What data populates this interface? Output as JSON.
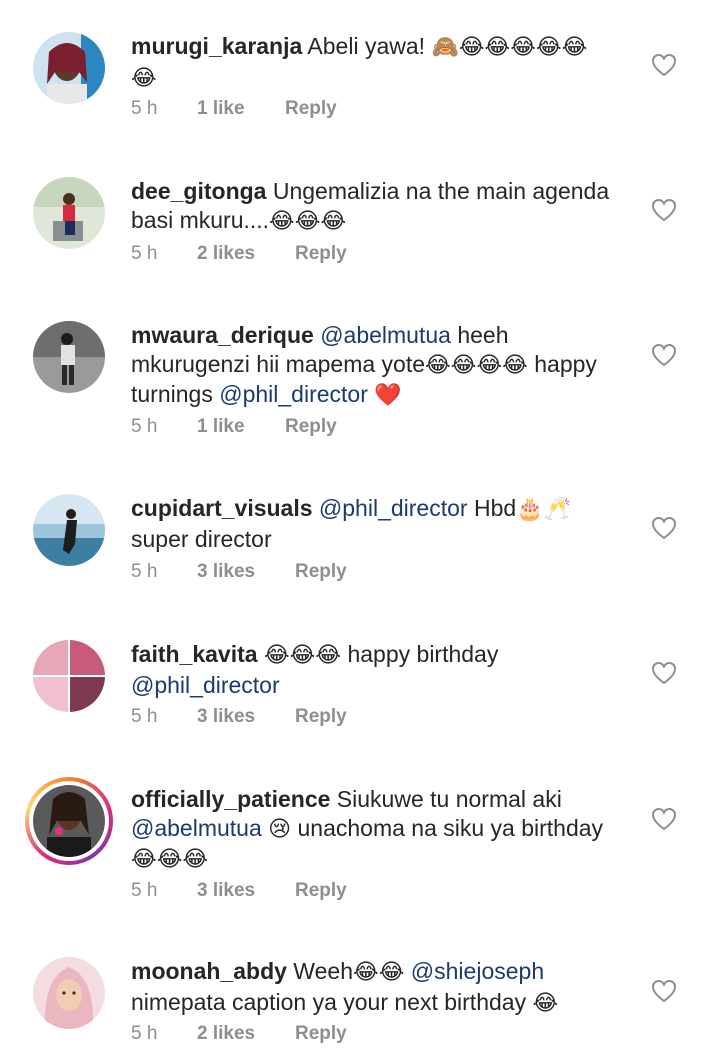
{
  "comments": [
    {
      "username": "murugi_karanja",
      "segments": [
        {
          "type": "text",
          "value": " Abeli yawa! "
        },
        {
          "type": "emoji",
          "value": "🙈😂😂😂😂😂"
        },
        {
          "type": "text",
          "value": " "
        },
        {
          "type": "emoji",
          "value": "😂"
        }
      ],
      "time": "5 h",
      "likes": "1 like",
      "reply": "Reply"
    },
    {
      "username": "dee_gitonga",
      "segments": [
        {
          "type": "text",
          "value": " Ungemalizia na the main agenda basi mkuru...."
        },
        {
          "type": "emoji",
          "value": "😂😂😂"
        }
      ],
      "time": "5 h",
      "likes": "2 likes",
      "reply": "Reply"
    },
    {
      "username": "mwaura_derique",
      "segments": [
        {
          "type": "text",
          "value": " "
        },
        {
          "type": "mention",
          "value": "@abelmutua"
        },
        {
          "type": "text",
          "value": " heeh mkurugenzi hii mapema yote"
        },
        {
          "type": "emoji",
          "value": "😂😂😂😂"
        },
        {
          "type": "text",
          "value": " happy turnings "
        },
        {
          "type": "mention",
          "value": "@phil_director"
        },
        {
          "type": "text",
          "value": " "
        },
        {
          "type": "emoji",
          "value": "❤️"
        }
      ],
      "time": "5 h",
      "likes": "1 like",
      "reply": "Reply"
    },
    {
      "username": "cupidart_visuals",
      "segments": [
        {
          "type": "text",
          "value": " "
        },
        {
          "type": "mention",
          "value": "@phil_director"
        },
        {
          "type": "text",
          "value": "  Hbd"
        },
        {
          "type": "emoji",
          "value": "🎂🥂"
        },
        {
          "type": "text",
          "value": " super director"
        }
      ],
      "time": "5 h",
      "likes": "3 likes",
      "reply": "Reply"
    },
    {
      "username": "faith_kavita",
      "segments": [
        {
          "type": "text",
          "value": " "
        },
        {
          "type": "emoji",
          "value": "😂😂😂"
        },
        {
          "type": "text",
          "value": " happy birthday "
        },
        {
          "type": "mention",
          "value": "@phil_director"
        }
      ],
      "time": "5 h",
      "likes": "3 likes",
      "reply": "Reply"
    },
    {
      "username": "officially_patience",
      "segments": [
        {
          "type": "text",
          "value": " Siukuwe tu normal aki "
        },
        {
          "type": "mention",
          "value": "@abelmutua"
        },
        {
          "type": "text",
          "value": " "
        },
        {
          "type": "emoji",
          "value": "😢"
        },
        {
          "type": "text",
          "value": " unachoma na siku ya birthday "
        },
        {
          "type": "emoji",
          "value": "😂😂😂"
        }
      ],
      "time": "5 h",
      "likes": "3 likes",
      "reply": "Reply"
    },
    {
      "username": "moonah_abdy",
      "segments": [
        {
          "type": "text",
          "value": " Weeh"
        },
        {
          "type": "emoji",
          "value": "😂😂"
        },
        {
          "type": "text",
          "value": " "
        },
        {
          "type": "mention",
          "value": "@shiejoseph"
        },
        {
          "type": "text",
          "value": " nimepata caption ya your next birthday "
        },
        {
          "type": "emoji",
          "value": "😂"
        }
      ],
      "time": "5 h",
      "likes": "2 likes",
      "reply": "Reply"
    }
  ]
}
